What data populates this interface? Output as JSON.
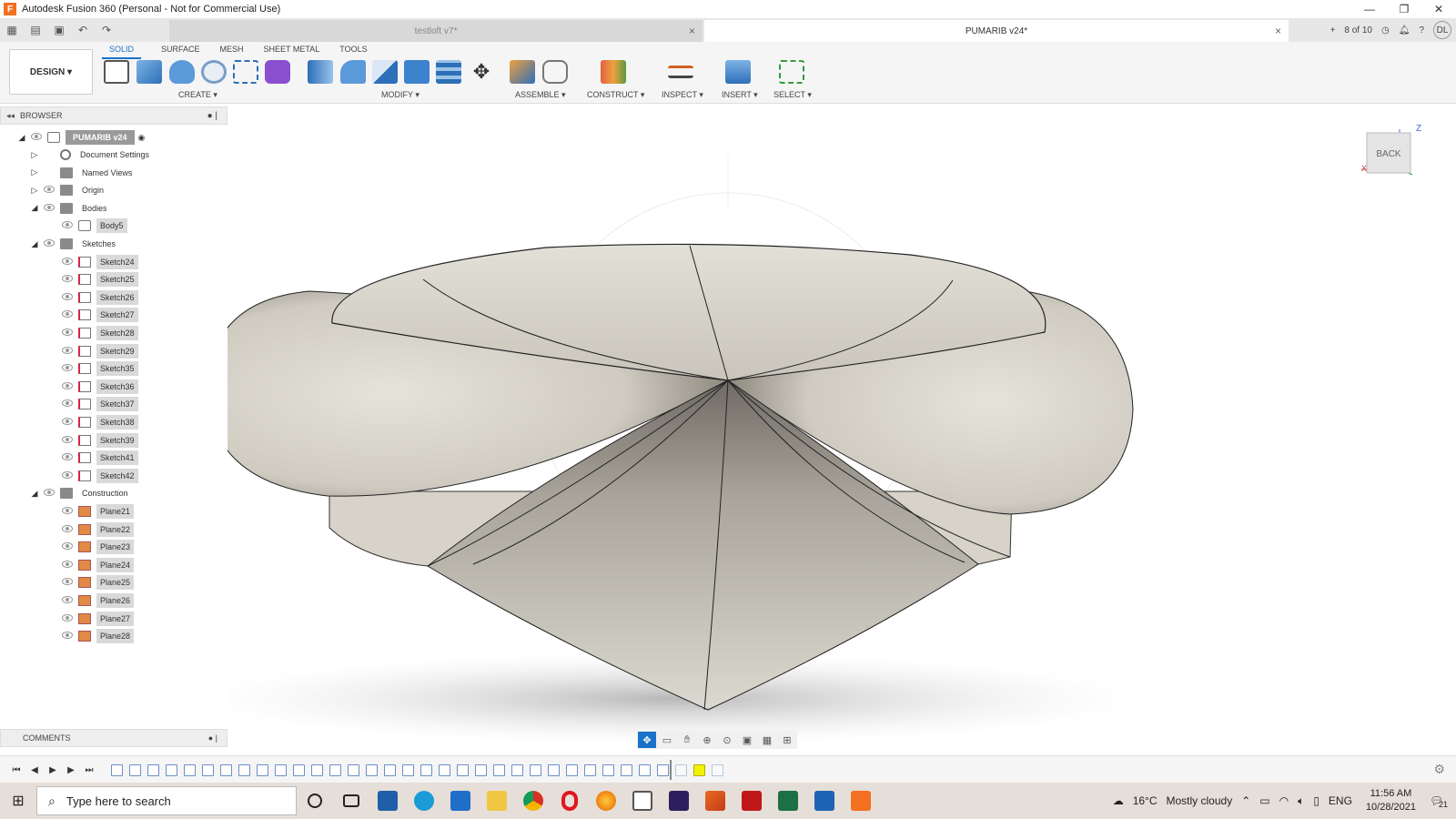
{
  "window": {
    "title": "Autodesk Fusion 360 (Personal - Not for Commercial Use)",
    "app_icon": "F",
    "minimize": "—",
    "restore": "❐",
    "close": "✕"
  },
  "tabs": {
    "inactive_label": "testloft v7*",
    "active_label": "PUMARIB v24*",
    "close": "×",
    "job_status": "8 of 10",
    "user_initials": "DL"
  },
  "toolbar": {
    "workspace": "DESIGN ▾",
    "mode_tabs": [
      "SOLID",
      "SURFACE",
      "MESH",
      "SHEET METAL",
      "TOOLS"
    ],
    "groups": [
      "CREATE ▾",
      "MODIFY ▾",
      "ASSEMBLE ▾",
      "CONSTRUCT ▾",
      "INSPECT ▾",
      "INSERT ▾",
      "SELECT ▾"
    ],
    "accent": "#1a73c8"
  },
  "browser": {
    "header": "BROWSER",
    "root": "PUMARIB v24",
    "items": [
      {
        "label": "Document Settings",
        "icon": "gear-icon"
      },
      {
        "label": "Named Views",
        "icon": "folder-icon"
      },
      {
        "label": "Origin",
        "icon": "folder-icon"
      },
      {
        "label": "Bodies",
        "icon": "folder-icon"
      },
      {
        "label": "Body5",
        "icon": "body-icon"
      },
      {
        "label": "Sketches",
        "icon": "folder-icon"
      },
      {
        "label": "Sketch24",
        "icon": "sketch-icon"
      },
      {
        "label": "Sketch25",
        "icon": "sketch-icon"
      },
      {
        "label": "Sketch26",
        "icon": "sketch-icon"
      },
      {
        "label": "Sketch27",
        "icon": "sketch-icon"
      },
      {
        "label": "Sketch28",
        "icon": "sketch-icon"
      },
      {
        "label": "Sketch29",
        "icon": "sketch-icon"
      },
      {
        "label": "Sketch35",
        "icon": "sketch-icon"
      },
      {
        "label": "Sketch36",
        "icon": "sketch-icon"
      },
      {
        "label": "Sketch37",
        "icon": "sketch-icon"
      },
      {
        "label": "Sketch38",
        "icon": "sketch-icon"
      },
      {
        "label": "Sketch39",
        "icon": "sketch-icon"
      },
      {
        "label": "Sketch41",
        "icon": "sketch-icon"
      },
      {
        "label": "Sketch42",
        "icon": "sketch-icon"
      },
      {
        "label": "Construction",
        "icon": "folder-icon"
      },
      {
        "label": "Plane21",
        "icon": "plane-icon"
      },
      {
        "label": "Plane22",
        "icon": "plane-icon"
      },
      {
        "label": "Plane23",
        "icon": "plane-icon"
      },
      {
        "label": "Plane24",
        "icon": "plane-icon"
      },
      {
        "label": "Plane25",
        "icon": "plane-icon"
      },
      {
        "label": "Plane26",
        "icon": "plane-icon"
      },
      {
        "label": "Plane27",
        "icon": "plane-icon"
      },
      {
        "label": "Plane28",
        "icon": "plane-icon"
      }
    ]
  },
  "comments": {
    "label": "COMMENTS"
  },
  "viewcube": {
    "face": "BACK",
    "z_label": "Z",
    "x_label": "X"
  },
  "taskbar": {
    "search_placeholder": "Type here to search",
    "weather_temp": "16°C",
    "weather_text": "Mostly cloudy",
    "language": "ENG",
    "time": "11:56 AM",
    "date": "10/28/2021",
    "notifications": "21"
  }
}
